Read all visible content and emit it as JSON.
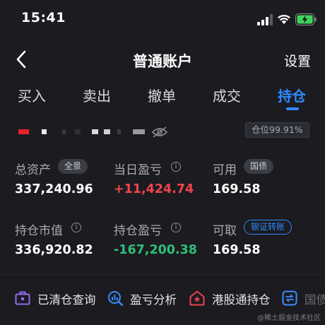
{
  "status_bar": {
    "time": "15:41"
  },
  "nav": {
    "title": "普通账户",
    "settings_label": "设置"
  },
  "tabs": [
    {
      "label": "买入",
      "active": false
    },
    {
      "label": "卖出",
      "active": false
    },
    {
      "label": "撤单",
      "active": false
    },
    {
      "label": "成交",
      "active": false
    },
    {
      "label": "持仓",
      "active": true
    }
  ],
  "account": {
    "position_ratio_label": "仓位99.91%"
  },
  "metrics": {
    "total_assets": {
      "label": "总资产",
      "tag": "全景",
      "value": "337,240.96"
    },
    "daily_pnl": {
      "label": "当日盈亏",
      "value": "+11,424.74"
    },
    "available": {
      "label": "可用",
      "tag": "国债",
      "value": "169.58"
    },
    "market_value": {
      "label": "持仓市值",
      "value": "336,920.82"
    },
    "position_pnl": {
      "label": "持仓盈亏",
      "value": "-167,200.38"
    },
    "withdrawable": {
      "label": "可取",
      "tag": "银证转账",
      "value": "169.58"
    }
  },
  "shortcuts": [
    {
      "label": "已清仓查询",
      "icon": "briefcase-icon"
    },
    {
      "label": "盈亏分析",
      "icon": "chart-search-icon"
    },
    {
      "label": "港股通持仓",
      "icon": "hk-stock-icon"
    },
    {
      "label": "国债",
      "icon": "swap-icon"
    }
  ],
  "watermark": "@稀土掘金技术社区",
  "colors": {
    "accent": "#2f8bff",
    "gain": "#f0464d",
    "loss": "#2fbf7a",
    "background": "#1b1b20"
  }
}
